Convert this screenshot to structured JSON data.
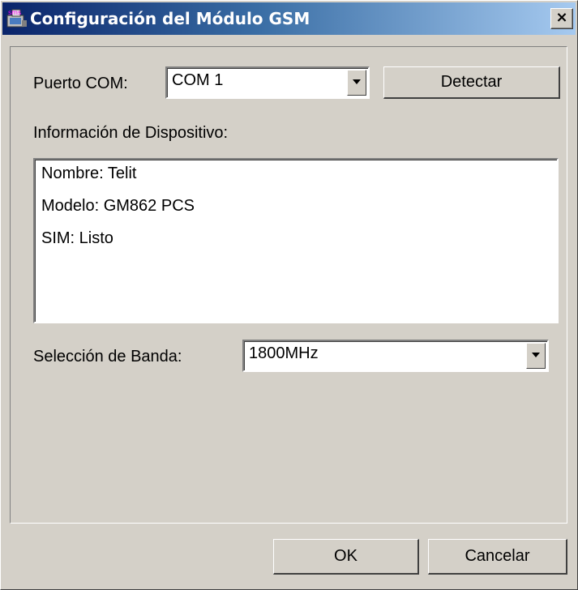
{
  "window": {
    "title": "Configuración del Módulo GSM",
    "close_label": "×"
  },
  "port": {
    "label": "Puerto COM:",
    "value": "COM 1",
    "detect_label": "Detectar"
  },
  "device": {
    "label": "Información de Dispositivo:",
    "lines": [
      "Nombre: Telit",
      "Modelo: GM862 PCS",
      "SIM: Listo"
    ]
  },
  "band": {
    "label": "Selección de Banda:",
    "value": "1800MHz"
  },
  "buttons": {
    "ok_label": "OK",
    "cancel_label": "Cancelar"
  }
}
